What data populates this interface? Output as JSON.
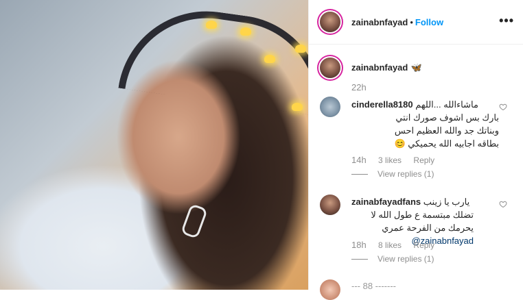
{
  "post": {
    "username": "zainabnfayad",
    "follow_label": "Follow",
    "separator": "•",
    "more_label": "•••"
  },
  "caption": {
    "username": "zainabnfayad",
    "emoji": "🦋",
    "time": "22h"
  },
  "comments": [
    {
      "username": "cinderella8180",
      "text_line1": "ماشاءالله ...اللهم",
      "text_rest": "بارك بس اشوف صورك انتي وبناتك جد والله العظيم احس بطاقه اجابيه الله يحميكي",
      "emoji": "😊",
      "time": "14h",
      "likes": "3 likes",
      "reply_label": "Reply",
      "view_replies": "View replies (1)"
    },
    {
      "username": "zainabfayadfans",
      "text_line1": "يارب يا زينب",
      "text_rest": "تضلك مبتسمة ع طول الله لا يحرمك من الفرحة عمري",
      "mention": "@zainabnfayad",
      "time": "18h",
      "likes": "8 likes",
      "reply_label": "Reply",
      "view_replies": "View replies (1)"
    }
  ],
  "partial_next": {
    "username_fragment": "--- 88 -------"
  },
  "colors": {
    "link": "#0095f6",
    "story_ring": "#d6249f",
    "muted": "#8e8e8e"
  },
  "icons": {
    "like": "heart-outline-icon",
    "more": "ellipsis-icon",
    "photo_decor": "butterfly-icon"
  }
}
